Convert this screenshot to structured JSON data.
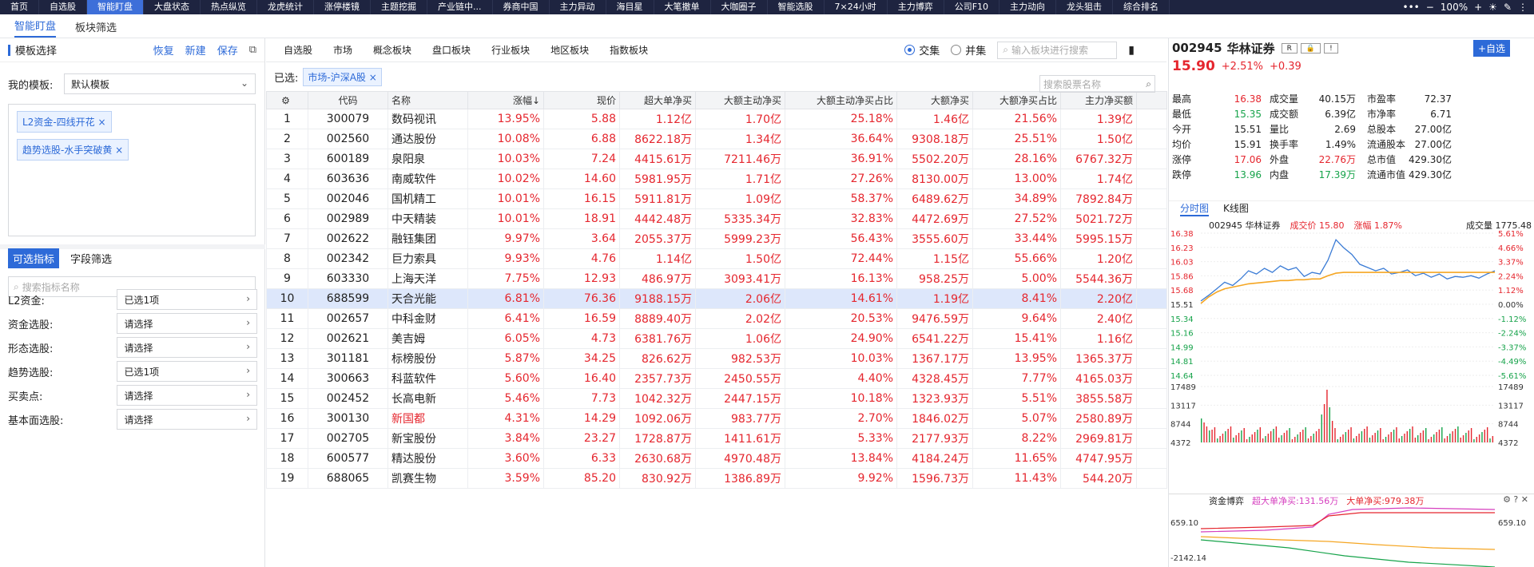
{
  "topnav": {
    "items": [
      "首页",
      "自选股",
      "智能盯盘",
      "大盘状态",
      "热点纵览",
      "龙虎统计",
      "涨停楼镜",
      "主题挖掘",
      "产业链中...",
      "券商中国",
      "主力异动",
      "海目星",
      "大笔撤单",
      "大咖圈子",
      "智能选股",
      "7×24小时",
      "主力博弈",
      "公司F10",
      "主力动向",
      "龙头狙击",
      "综合排名"
    ],
    "active": 2,
    "zoom": "100%"
  },
  "subtabs": [
    "智能盯盘",
    "板块筛选"
  ],
  "left": {
    "title": "模板选择",
    "actions": [
      "恢复",
      "新建",
      "保存"
    ],
    "my_template_label": "我的模板:",
    "my_template_value": "默认模板",
    "chips": [
      "L2资金-四线开花 ×",
      "趋势选股-水手突破黄 ×"
    ],
    "tabs": [
      "可选指标",
      "字段筛选"
    ],
    "search_placeholder": "搜索指标名称",
    "filters": [
      {
        "label": "L2资金:",
        "value": "已选1项"
      },
      {
        "label": "资金选股:",
        "value": "请选择"
      },
      {
        "label": "形态选股:",
        "value": "请选择"
      },
      {
        "label": "趋势选股:",
        "value": "已选1项"
      },
      {
        "label": "买卖点:",
        "value": "请选择"
      },
      {
        "label": "基本面选股:",
        "value": "请选择"
      }
    ]
  },
  "center": {
    "tabs": [
      "自选股",
      "市场",
      "概念板块",
      "盘口板块",
      "行业板块",
      "地区板块",
      "指数板块"
    ],
    "radio": [
      "交集",
      "并集"
    ],
    "board_search": "输入板块进行搜索",
    "selected_label": "已选:",
    "selected_chip": "市场-沪深A股 ×",
    "stock_search": "搜索股票名称",
    "columns": [
      "代码",
      "名称",
      "涨幅↓",
      "现价",
      "超大单净买",
      "大额主动净买",
      "大额主动净买占比",
      "大额净买",
      "大额净买占比",
      "主力净买额"
    ],
    "rows": [
      [
        "1",
        "300079",
        "数码视讯",
        "13.95%",
        "5.88",
        "1.12亿",
        "1.70亿",
        "25.18%",
        "1.46亿",
        "21.56%",
        "1.39亿"
      ],
      [
        "2",
        "002560",
        "通达股份",
        "10.08%",
        "6.88",
        "8622.18万",
        "1.34亿",
        "36.64%",
        "9308.18万",
        "25.51%",
        "1.50亿"
      ],
      [
        "3",
        "600189",
        "泉阳泉",
        "10.03%",
        "7.24",
        "4415.61万",
        "7211.46万",
        "36.91%",
        "5502.20万",
        "28.16%",
        "6767.32万"
      ],
      [
        "4",
        "603636",
        "南威软件",
        "10.02%",
        "14.60",
        "5981.95万",
        "1.71亿",
        "27.26%",
        "8130.00万",
        "13.00%",
        "1.74亿"
      ],
      [
        "5",
        "002046",
        "国机精工",
        "10.01%",
        "16.15",
        "5911.81万",
        "1.09亿",
        "58.37%",
        "6489.62万",
        "34.89%",
        "7892.84万"
      ],
      [
        "6",
        "002989",
        "中天精装",
        "10.01%",
        "18.91",
        "4442.48万",
        "5335.34万",
        "32.83%",
        "4472.69万",
        "27.52%",
        "5021.72万"
      ],
      [
        "7",
        "002622",
        "融钰集团",
        "9.97%",
        "3.64",
        "2055.37万",
        "5999.23万",
        "56.43%",
        "3555.60万",
        "33.44%",
        "5995.15万"
      ],
      [
        "8",
        "002342",
        "巨力索具",
        "9.93%",
        "4.76",
        "1.14亿",
        "1.50亿",
        "72.44%",
        "1.15亿",
        "55.66%",
        "1.20亿"
      ],
      [
        "9",
        "603330",
        "上海天洋",
        "7.75%",
        "12.93",
        "486.97万",
        "3093.41万",
        "16.13%",
        "958.25万",
        "5.00%",
        "5544.36万"
      ],
      [
        "10",
        "688599",
        "天合光能",
        "6.81%",
        "76.36",
        "9188.15万",
        "2.06亿",
        "14.61%",
        "1.19亿",
        "8.41%",
        "2.20亿"
      ],
      [
        "11",
        "002657",
        "中科金财",
        "6.41%",
        "16.59",
        "8889.40万",
        "2.02亿",
        "20.53%",
        "9476.59万",
        "9.64%",
        "2.40亿"
      ],
      [
        "12",
        "002621",
        "美吉姆",
        "6.05%",
        "4.73",
        "6381.76万",
        "1.06亿",
        "24.90%",
        "6541.22万",
        "15.41%",
        "1.16亿"
      ],
      [
        "13",
        "301181",
        "标榜股份",
        "5.87%",
        "34.25",
        "826.62万",
        "982.53万",
        "10.03%",
        "1367.17万",
        "13.95%",
        "1365.37万"
      ],
      [
        "14",
        "300663",
        "科蓝软件",
        "5.60%",
        "16.40",
        "2357.73万",
        "2450.55万",
        "4.40%",
        "4328.45万",
        "7.77%",
        "4165.03万"
      ],
      [
        "15",
        "002452",
        "长高电新",
        "5.46%",
        "7.73",
        "1042.32万",
        "2447.15万",
        "10.18%",
        "1323.93万",
        "5.51%",
        "3855.58万"
      ],
      [
        "16",
        "300130",
        "新国都",
        "4.31%",
        "14.29",
        "1092.06万",
        "983.77万",
        "2.70%",
        "1846.02万",
        "5.07%",
        "2580.89万"
      ],
      [
        "17",
        "002705",
        "新宝股份",
        "3.84%",
        "23.27",
        "1728.87万",
        "1411.61万",
        "5.33%",
        "2177.93万",
        "8.22%",
        "2969.81万"
      ],
      [
        "18",
        "600577",
        "精达股份",
        "3.60%",
        "6.33",
        "2630.68万",
        "4970.48万",
        "13.84%",
        "4184.24万",
        "11.65%",
        "4747.95万"
      ],
      [
        "19",
        "688065",
        "凯赛生物",
        "3.59%",
        "85.20",
        "830.92万",
        "1386.89万",
        "9.92%",
        "1596.73万",
        "11.43%",
        "544.20万"
      ]
    ],
    "highlight_row": 9,
    "red_name_row": 15
  },
  "right": {
    "code": "002945",
    "name": "华林证券",
    "r_badge": "R",
    "add": "+自选",
    "price": "15.90",
    "chg_pct": "+2.51%",
    "chg": "+0.39",
    "quote": [
      [
        "最高",
        "16.38",
        "成交量",
        "40.15万",
        "市盈率",
        "72.37"
      ],
      [
        "最低",
        "15.35",
        "成交额",
        "6.39亿",
        "市净率",
        "6.71"
      ],
      [
        "今开",
        "15.51",
        "量比",
        "2.69",
        "总股本",
        "27.00亿"
      ],
      [
        "均价",
        "15.91",
        "换手率",
        "1.49%",
        "流通股本",
        "27.00亿"
      ],
      [
        "涨停",
        "17.06",
        "外盘",
        "22.76万",
        "总市值",
        "429.30亿"
      ],
      [
        "跌停",
        "13.96",
        "内盘",
        "17.39万",
        "流通市值",
        "429.30亿"
      ]
    ],
    "chart_tabs": [
      "分时图",
      "K线图"
    ],
    "chart_info": {
      "name": "002945 华林证券",
      "price": "成交价 15.80",
      "pct": "涨幅 1.87%",
      "vol": "成交量 1775.48"
    },
    "flow_info": {
      "title": "资金博弈",
      "a": "超大单净买:131.56万",
      "b": "大单净买:979.38万"
    },
    "flow_axis": [
      "659.10",
      "-2142.14"
    ],
    "colors": {
      "red": "#e5262e",
      "green": "#16a34a",
      "blue": "#2d6ad8",
      "orange": "#f5a623"
    }
  },
  "chart_data": {
    "type": "line",
    "title": "",
    "y_left": [
      "16.38",
      "16.23",
      "16.03",
      "15.86",
      "15.68",
      "15.51",
      "15.34",
      "15.16",
      "14.99",
      "14.81",
      "14.64"
    ],
    "y_right": [
      "5.61%",
      "4.66%",
      "3.37%",
      "2.24%",
      "1.12%",
      "0.00%",
      "-1.12%",
      "-2.24%",
      "-3.37%",
      "-4.49%",
      "-5.61%"
    ],
    "ylim": [
      14.64,
      16.38
    ],
    "vol_axis": [
      "17489",
      "13117",
      "8744",
      "4372"
    ],
    "price": [
      15.55,
      15.62,
      15.7,
      15.78,
      15.74,
      15.82,
      15.92,
      15.88,
      15.95,
      15.9,
      15.98,
      15.93,
      15.96,
      15.85,
      15.9,
      15.88,
      16.05,
      16.3,
      16.2,
      16.12,
      16.0,
      15.96,
      15.92,
      15.95,
      15.88,
      15.9,
      15.93,
      15.86,
      15.89,
      15.84,
      15.88,
      15.82,
      15.85,
      15.84,
      15.86,
      15.83,
      15.88,
      15.92
    ],
    "avg": [
      15.52,
      15.6,
      15.66,
      15.7,
      15.72,
      15.74,
      15.76,
      15.77,
      15.78,
      15.79,
      15.8,
      15.8,
      15.81,
      15.81,
      15.82,
      15.82,
      15.86,
      15.89,
      15.9,
      15.9,
      15.9,
      15.9,
      15.9,
      15.9,
      15.9,
      15.9,
      15.9,
      15.9,
      15.9,
      15.9,
      15.9,
      15.9,
      15.9,
      15.9,
      15.9,
      15.9,
      15.9,
      15.9
    ]
  }
}
